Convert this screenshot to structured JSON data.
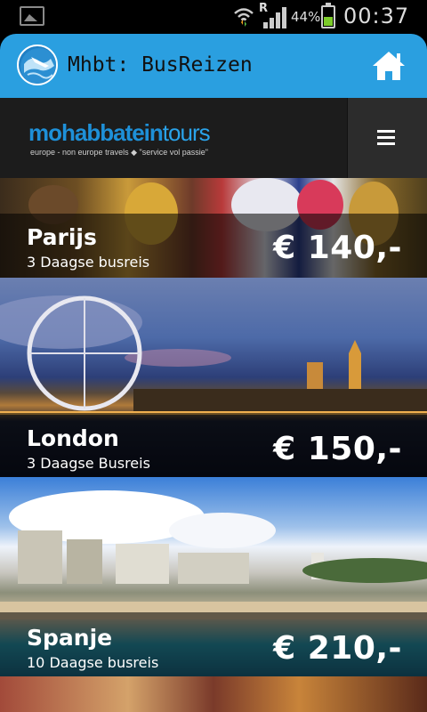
{
  "status_bar": {
    "roaming": "R",
    "battery_percent": "44%",
    "time": "00:37",
    "icons": [
      "gallery-notification-icon",
      "wifi-icon",
      "signal-icon",
      "battery-icon"
    ]
  },
  "action_bar": {
    "title": "Mhbt: BusReizen",
    "icons": [
      "app-globe-logo-icon",
      "home-icon"
    ],
    "accent_color": "#2a9fe0"
  },
  "brand": {
    "name_bold": "mohabbatein",
    "name_light": "tours",
    "tagline": "europe - non europe travels ◆ \"service vol passie\"",
    "menu_icon": "hamburger-menu-icon"
  },
  "tours": [
    {
      "name": "Parijs",
      "subtitle": "3 Daagse busreis",
      "price": "€ 140,-"
    },
    {
      "name": "London",
      "subtitle": "3 Daagse Busreis",
      "price": "€ 150,-"
    },
    {
      "name": "Spanje",
      "subtitle": "10 Daagse busreis",
      "price": "€ 210,-"
    }
  ]
}
